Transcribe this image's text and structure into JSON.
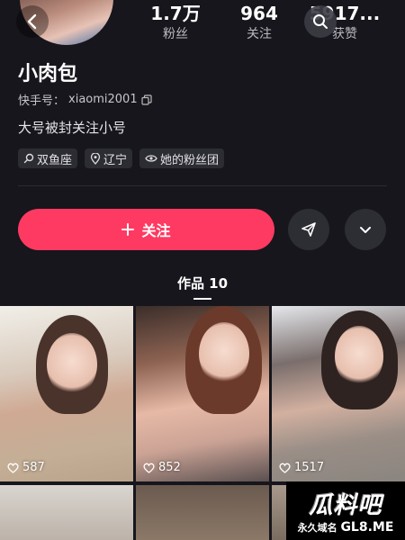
{
  "header": {
    "stats": [
      {
        "value": "1.7万",
        "label": "粉丝"
      },
      {
        "value": "964",
        "label": "关注"
      },
      {
        "value": "5917...",
        "label": "获赞"
      }
    ]
  },
  "profile": {
    "name": "小肉包",
    "uid_label": "快手号：",
    "uid": "xiaomi2001",
    "bio": "大号被封关注小号",
    "tags": [
      {
        "icon": "search-icon",
        "text": "双鱼座"
      },
      {
        "icon": "location-pin-icon",
        "text": "辽宁"
      },
      {
        "icon": "eye-icon",
        "text": "她的粉丝团"
      }
    ]
  },
  "actions": {
    "follow_label": "关注",
    "share_icon": "send-icon",
    "more_icon": "chevron-down-icon"
  },
  "works": {
    "tab_label": "作品 10",
    "items": [
      {
        "likes": "587"
      },
      {
        "likes": "852"
      },
      {
        "likes": "1517"
      }
    ]
  },
  "watermark": {
    "logo": "瓜料吧",
    "tagline": "永久域名",
    "domain": "GL8.ME"
  },
  "colors": {
    "background": "#16161c",
    "accent": "#fe3a62"
  }
}
